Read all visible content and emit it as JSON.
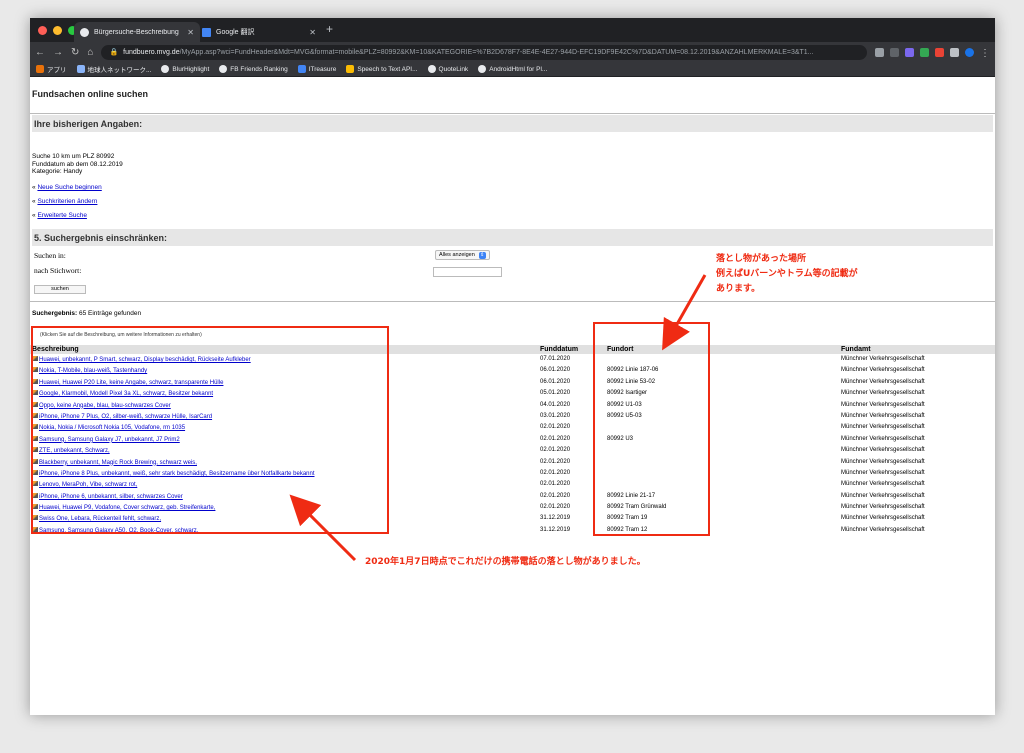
{
  "browser": {
    "tabs": [
      {
        "label": "Bürgersuche-Beschreibung"
      },
      {
        "label": "Google 翻訳"
      }
    ],
    "url_host": "fundbuero.mvg.de",
    "url_rest": "/MyApp.asp?wci=FundHeader&Mdt=MVG&format=mobile&PLZ=80992&KM=10&KATEGORIE=%7B2D678F7-8E4E-4E27-944D-EFC19DF9E42C%7D&DATUM=08.12.2019&ANZAHLMERKMALE=3&T1...",
    "bookmarks": [
      "アプリ",
      "地球人ネットワーク...",
      "BlurHighlight",
      "FB Friends Ranking",
      "ITreasure",
      "Speech to Text API...",
      "QuoteLink",
      "AndroidHtml for Pl..."
    ]
  },
  "page": {
    "title": "Fundsachen online suchen",
    "section1": "Ihre bisherigen Angaben:",
    "info": [
      "Suche 10 km um PLZ 80992",
      "Funddatum ab dem 08.12.2019",
      "Kategorie: Handy"
    ],
    "links": {
      "prefix": "«",
      "new_search": "Neue Suche beginnen",
      "change_criteria": "Suchkriterien ändern",
      "extended": "Erweiterte Suche"
    },
    "section2": "5. Suchergebnis einschränken:",
    "filter": {
      "suchen_in_label": "Suchen in:",
      "select_value": "Alles anzeigen",
      "keyword_label": "nach Stichwort:",
      "submit": "suchen"
    },
    "result_label": "Suchergebnis:",
    "result_text": "65 Einträge gefunden",
    "hint": "(Klicken Sie auf die Beschreibung, um weitere Informationen zu erhalten)",
    "columns": [
      "Beschreibung",
      "Funddatum",
      "Fundort",
      "Fundamt"
    ],
    "rows": [
      {
        "desc": "Huawei, unbekannt, P Smart, schwarz, Display beschädigt, Rückseite Aufkleber",
        "date": "07.01.2020",
        "place": "",
        "office": "Münchner Verkehrsgesellschaft"
      },
      {
        "desc": "Nokia, T-Mobile, blau-weiß, Tastenhandy",
        "date": "06.01.2020",
        "place": "80992 Linie 187-06",
        "office": "Münchner Verkehrsgesellschaft"
      },
      {
        "desc": "Huawei, Huawei P20 Lite, keine Angabe, schwarz, transparente Hülle",
        "date": "06.01.2020",
        "place": "80992 Linie 53-02",
        "office": "Münchner Verkehrsgesellschaft"
      },
      {
        "desc": "Google, Klarmobil, Modell Pixel 3a XL, schwarz, Besitzer bekannt",
        "date": "05.01.2020",
        "place": "80992 Isartiger",
        "office": "Münchner Verkehrsgesellschaft"
      },
      {
        "desc": "Oppo, keine Angabe, blau, blau-schwarzes Cover",
        "date": "04.01.2020",
        "place": "80992 U1-03",
        "office": "Münchner Verkehrsgesellschaft"
      },
      {
        "desc": "iPhone, iPhone 7 Plus, O2, silber-weiß, schwarze Hülle, IsarCard",
        "date": "03.01.2020",
        "place": "80992 U5-03",
        "office": "Münchner Verkehrsgesellschaft"
      },
      {
        "desc": "Nokia, Nokia / Microsoft Nokia 105, Vodafone, rm 1035",
        "date": "02.01.2020",
        "place": "",
        "office": "Münchner Verkehrsgesellschaft"
      },
      {
        "desc": "Samsung, Samsung Galaxy J7, unbekannt, J7 Prim2",
        "date": "02.01.2020",
        "place": "80992 U3",
        "office": "Münchner Verkehrsgesellschaft"
      },
      {
        "desc": "ZTE, unbekannt, Schwarz,",
        "date": "02.01.2020",
        "place": "",
        "office": "Münchner Verkehrsgesellschaft"
      },
      {
        "desc": "Blackberry, unbekannt, Magic Rock Brewing, schwarz weis,",
        "date": "02.01.2020",
        "place": "",
        "office": "Münchner Verkehrsgesellschaft"
      },
      {
        "desc": "iPhone, iPhone 8 Plus, unbekannt, weiß, sehr stark beschädigt, Besitzername über Notfallkarte bekannt",
        "date": "02.01.2020",
        "place": "",
        "office": "Münchner Verkehrsgesellschaft"
      },
      {
        "desc": "Lenovo, MeraPoh, Vibe, schwarz rot,",
        "date": "02.01.2020",
        "place": "",
        "office": "Münchner Verkehrsgesellschaft"
      },
      {
        "desc": "iPhone, iPhone 6, unbekannt, silber, schwarzes Cover",
        "date": "02.01.2020",
        "place": "80992 Linie 21-17",
        "office": "Münchner Verkehrsgesellschaft"
      },
      {
        "desc": "Huawei, Huawei P9, Vodafone, Cover schwarz, geb. Streifenkarte,",
        "date": "02.01.2020",
        "place": "80992 Tram Grünwald",
        "office": "Münchner Verkehrsgesellschaft"
      },
      {
        "desc": "Swiss One, Lebara, Rückenteil fehlt, schwarz,",
        "date": "31.12.2019",
        "place": "80992 Tram 19",
        "office": "Münchner Verkehrsgesellschaft"
      },
      {
        "desc": "Samsung, Samsung Galaxy A50, O2, Book-Cover, schwarz,",
        "date": "31.12.2019",
        "place": "80992 Tram 12",
        "office": "Münchner Verkehrsgesellschaft"
      }
    ]
  },
  "annotations": {
    "note_top": [
      "落とし物があった場所",
      "例えばUバーンやトラム等の記載が",
      "あります。"
    ],
    "note_bottom": "2020年1月7日時点でこれだけの携帯電話の落とし物がありました。",
    "color": "#ef2b13"
  }
}
